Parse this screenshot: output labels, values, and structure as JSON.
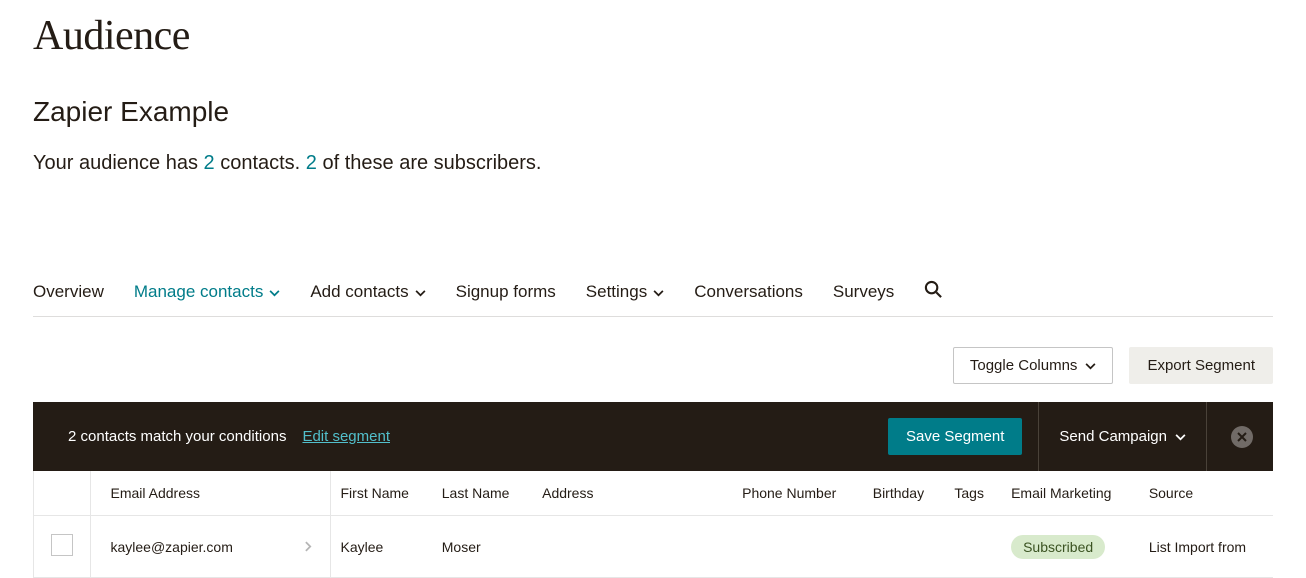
{
  "page": {
    "title": "Audience",
    "audience_name": "Zapier Example",
    "summary_prefix": "Your audience has ",
    "contacts_count": "2",
    "summary_mid": " contacts. ",
    "subscribers_count": "2",
    "summary_suffix": " of these are subscribers."
  },
  "tabs": {
    "overview": "Overview",
    "manage_contacts": "Manage contacts",
    "add_contacts": "Add contacts",
    "signup_forms": "Signup forms",
    "settings": "Settings",
    "conversations": "Conversations",
    "surveys": "Surveys"
  },
  "actions": {
    "toggle_columns": "Toggle Columns",
    "export_segment": "Export Segment"
  },
  "segment_bar": {
    "match_text": "2 contacts match your conditions",
    "edit_segment": "Edit segment",
    "save_segment": "Save Segment",
    "send_campaign": "Send Campaign"
  },
  "table": {
    "headers": {
      "email": "Email Address",
      "first_name": "First Name",
      "last_name": "Last Name",
      "address": "Address",
      "phone": "Phone Number",
      "birthday": "Birthday",
      "tags": "Tags",
      "email_marketing": "Email Marketing",
      "source": "Source"
    },
    "rows": [
      {
        "email": "kaylee@zapier.com",
        "first_name": "Kaylee",
        "last_name": "Moser",
        "address": "",
        "phone": "",
        "birthday": "",
        "tags": "",
        "email_marketing": "Subscribed",
        "source": "List Import from"
      }
    ]
  }
}
